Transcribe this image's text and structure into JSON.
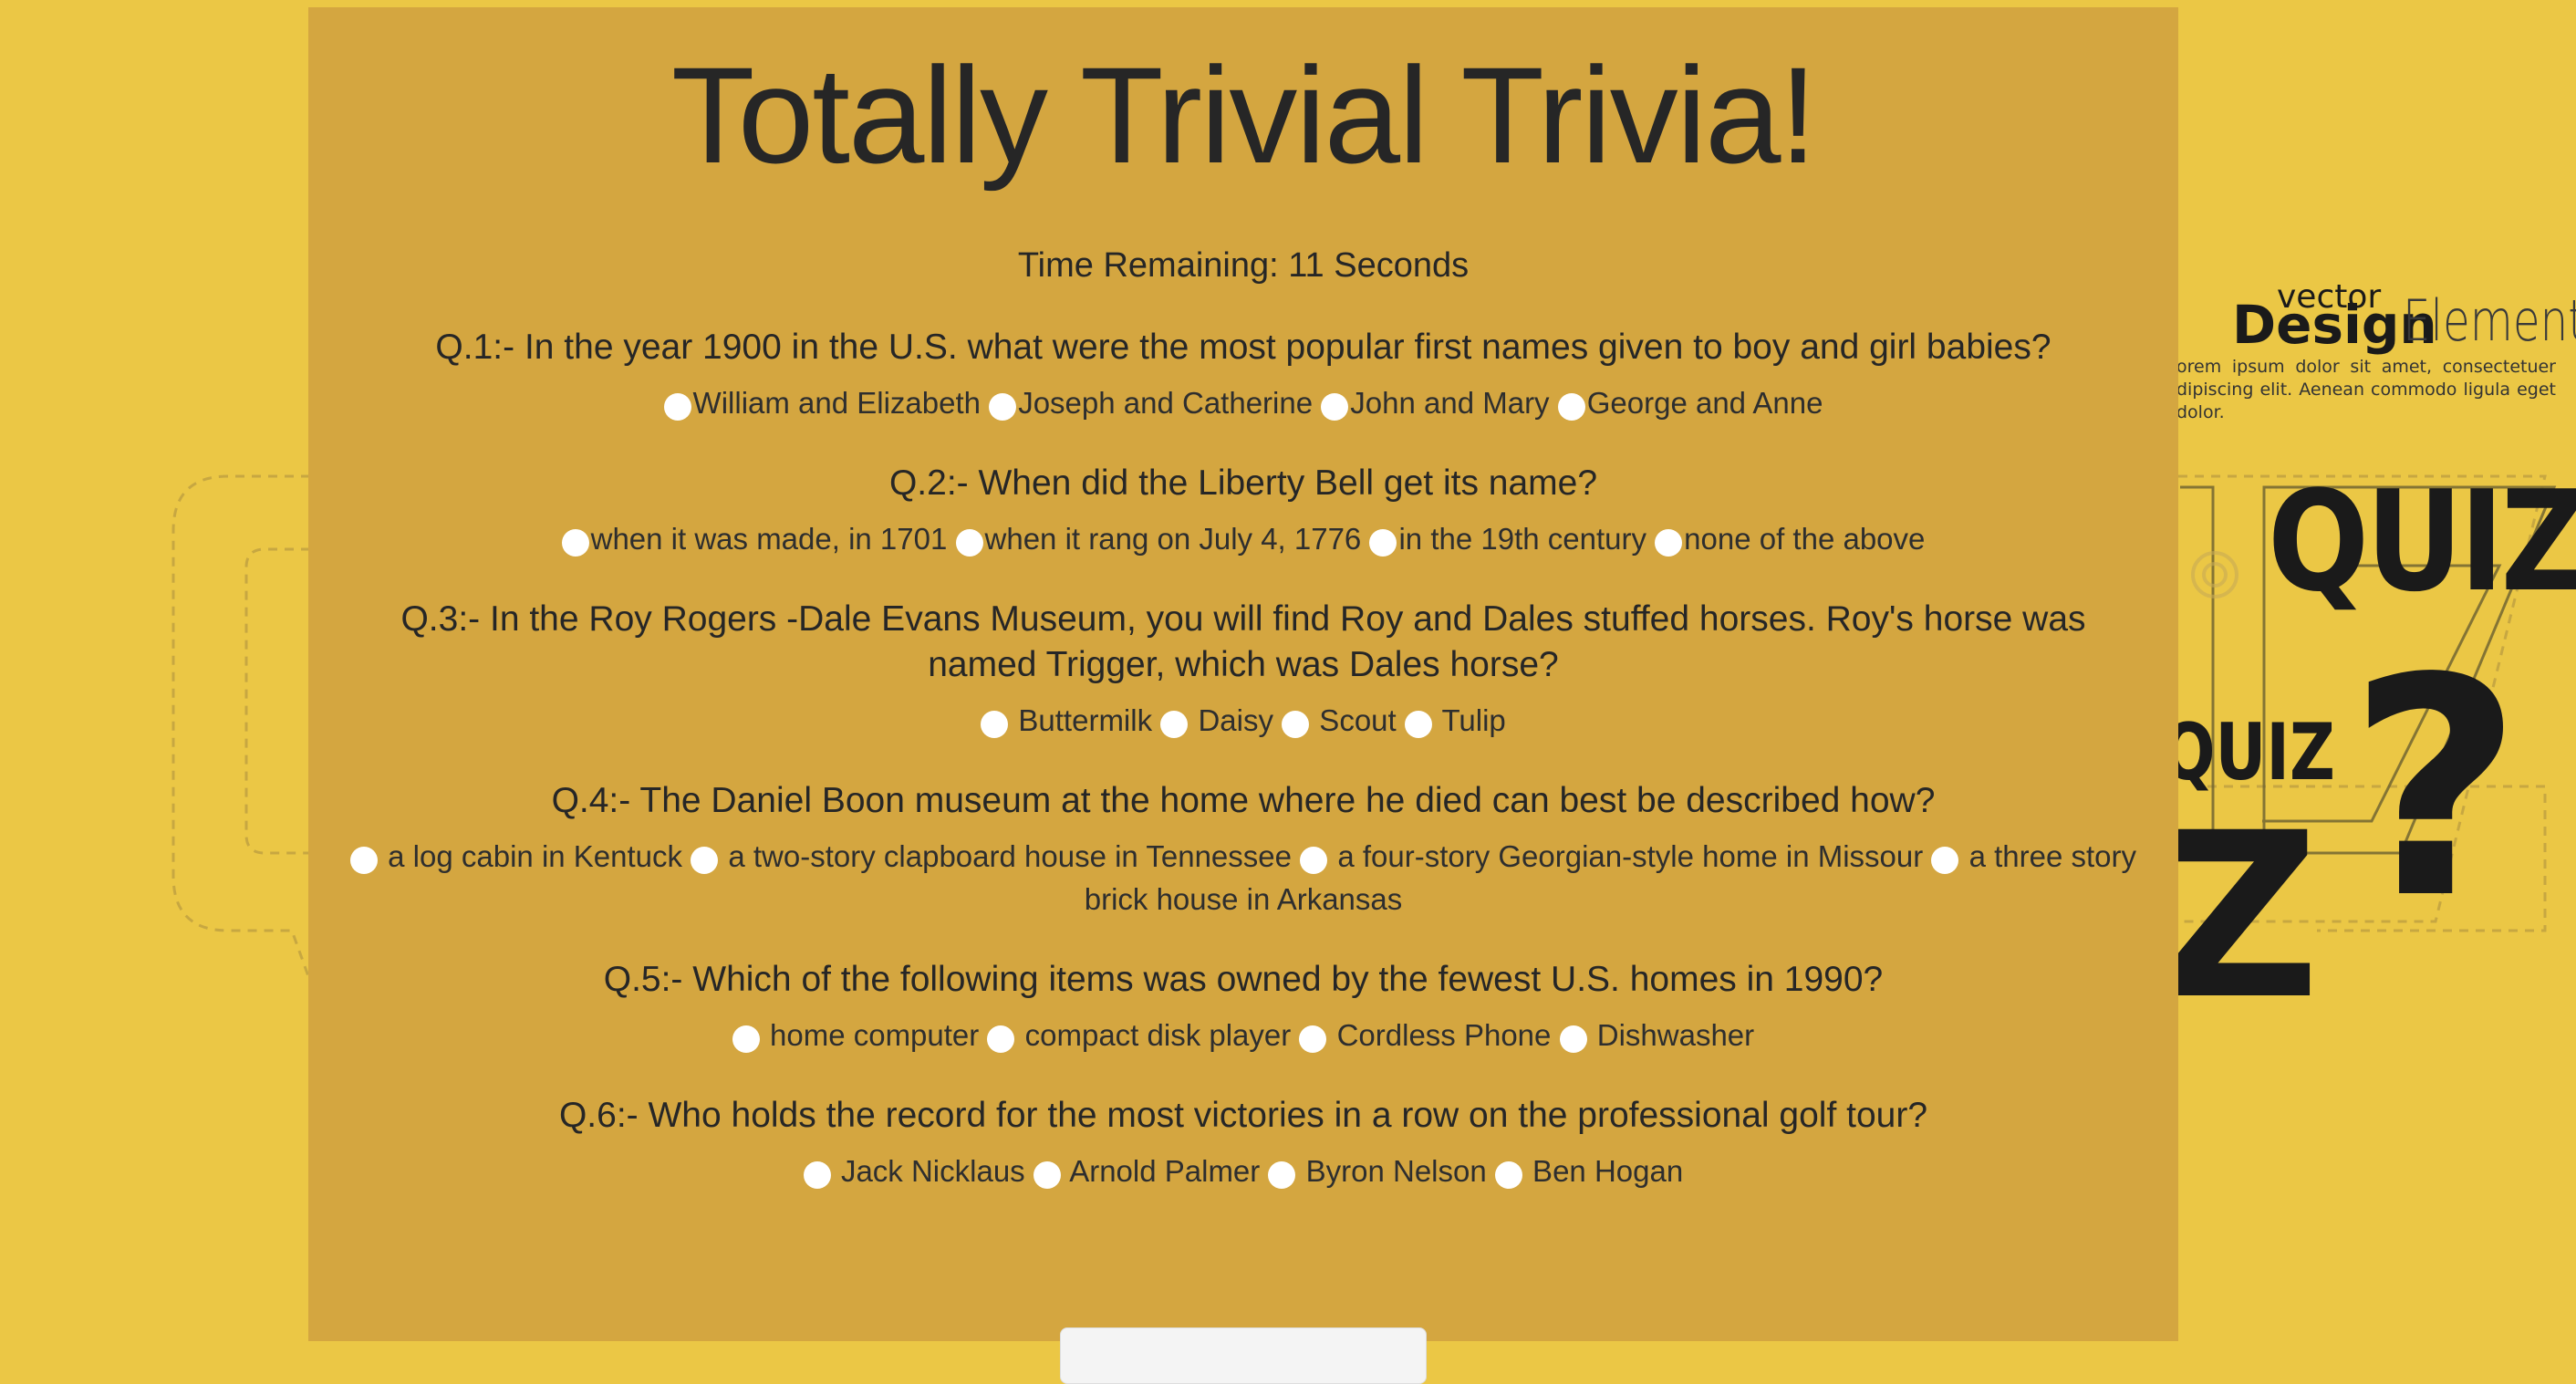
{
  "page": {
    "title": "Totally Trivial Trivia!",
    "timer": "Time Remaining: 11 Seconds"
  },
  "colors": {
    "background": "#ebc745",
    "panel": "#d4a640",
    "text": "#262626",
    "radio": "#ffffff"
  },
  "background_art": {
    "vector": "vector",
    "design": "Design",
    "element": "Element",
    "lorem": "orem ipsum dolor sit amet, consectetuer dipiscing elit. Aenean commodo ligula eget dolor.",
    "quiz_big": "QUIZ",
    "quiz_small": "QUIZ",
    "question_mark": "?",
    "z_letter": "Z"
  },
  "questions": [
    {
      "text": "Q.1:- In the year 1900 in the U.S. what were the most popular first names given to boy and girl babies?",
      "options": [
        "William and Elizabeth",
        "Joseph and Catherine",
        "John and Mary",
        "George and Anne"
      ]
    },
    {
      "text": "Q.2:- When did the Liberty Bell get its name?",
      "options": [
        "when it was made, in 1701",
        "when it rang on July 4, 1776",
        "in the 19th century",
        "none of the above"
      ]
    },
    {
      "text": "Q.3:- In the Roy Rogers -Dale Evans Museum, you will find Roy and Dales stuffed horses. Roy's horse was named Trigger, which was Dales horse?",
      "options": [
        " Buttermilk",
        " Daisy",
        " Scout",
        " Tulip"
      ]
    },
    {
      "text": "Q.4:- The Daniel Boon museum at the home where he died can best be described how?",
      "options": [
        " a log cabin in Kentuck",
        " a two-story clapboard house in Tennessee",
        " a four-story Georgian-style home in Missour",
        " a three story brick house in Arkansas"
      ]
    },
    {
      "text": "Q.5:- Which of the following items was owned by the fewest U.S. homes in 1990?",
      "options": [
        " home computer",
        " compact disk player",
        " Cordless Phone",
        " Dishwasher"
      ]
    },
    {
      "text": "Q.6:- Who holds the record for the most victories in a row on the professional golf tour?",
      "options": [
        " Jack Nicklaus",
        " Arnold Palmer",
        " Byron Nelson",
        " Ben Hogan"
      ]
    }
  ]
}
